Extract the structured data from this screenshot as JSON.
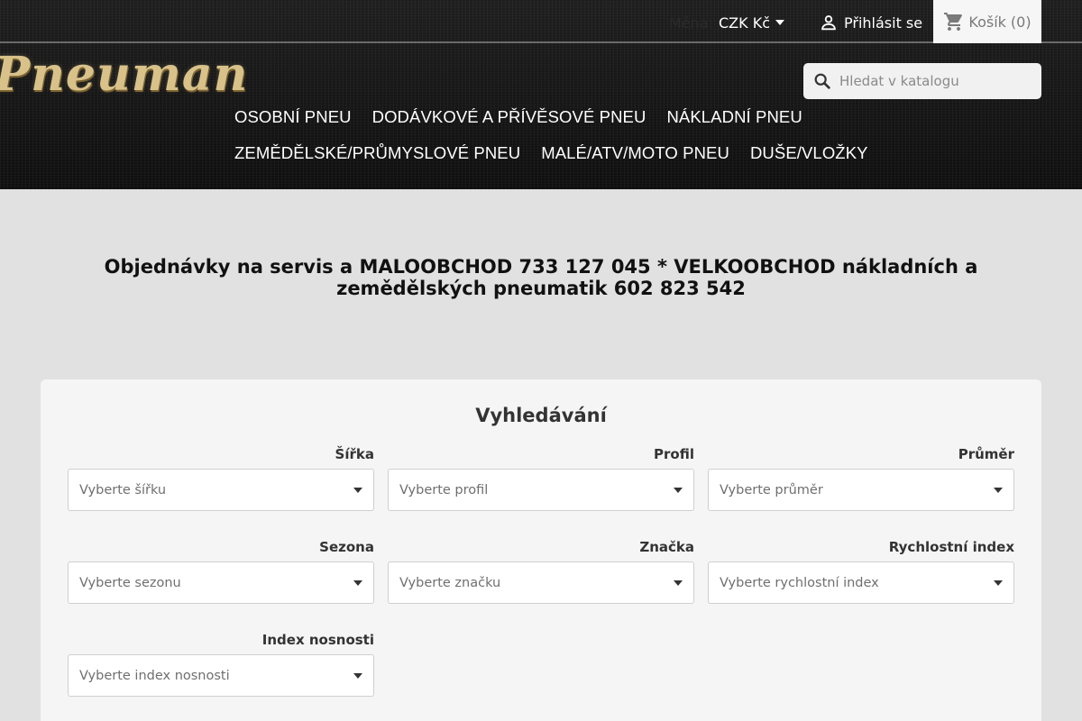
{
  "header": {
    "currency": {
      "label": "Měna:",
      "value": "CZK Kč"
    },
    "login_label": "Přihlásit se",
    "cart": {
      "label": "Košík",
      "count": "(0)"
    },
    "logo_text": "Pneuman",
    "search": {
      "placeholder": "Hledat v katalogu"
    },
    "nav": {
      "row1": [
        "OSOBNÍ PNEU",
        "DODÁVKOVÉ A PŘÍVĚSOVÉ PNEU",
        "NÁKLADNÍ PNEU"
      ],
      "row2": [
        "ZEMĚDĚLSKÉ/PRŮMYSLOVÉ PNEU",
        "MALÉ/ATV/MOTO PNEU",
        "DUŠE/VLOŽKY"
      ]
    }
  },
  "announcement": {
    "line1": "Objednávky na servis a MALOOBCHOD 733 127 045 * VELKOOBCHOD nákladních a",
    "line2": "zemědělských pneumatik 602 823 542"
  },
  "filter": {
    "title": "Vyhledávání",
    "fields": [
      {
        "label": "Šířka",
        "placeholder": "Vyberte šířku"
      },
      {
        "label": "Profil",
        "placeholder": "Vyberte profil"
      },
      {
        "label": "Průměr",
        "placeholder": "Vyberte průměr"
      },
      {
        "label": "Sezona",
        "placeholder": "Vyberte sezonu"
      },
      {
        "label": "Značka",
        "placeholder": "Vyberte značku"
      },
      {
        "label": "Rychlostní index",
        "placeholder": "Vyberte rychlostní index"
      },
      {
        "label": "Index nosnosti",
        "placeholder": "Vyberte index nosnosti"
      }
    ]
  },
  "colors": {
    "header_bg": "#161616",
    "page_bg": "#e1e1e1",
    "logo_gold": "#d9c28a",
    "card_bg": "#f5f5f6"
  },
  "icons": {
    "login": "person-icon",
    "cart": "shopping-cart-icon",
    "search": "magnifier-icon",
    "select_arrow": "caret-down-icon"
  }
}
